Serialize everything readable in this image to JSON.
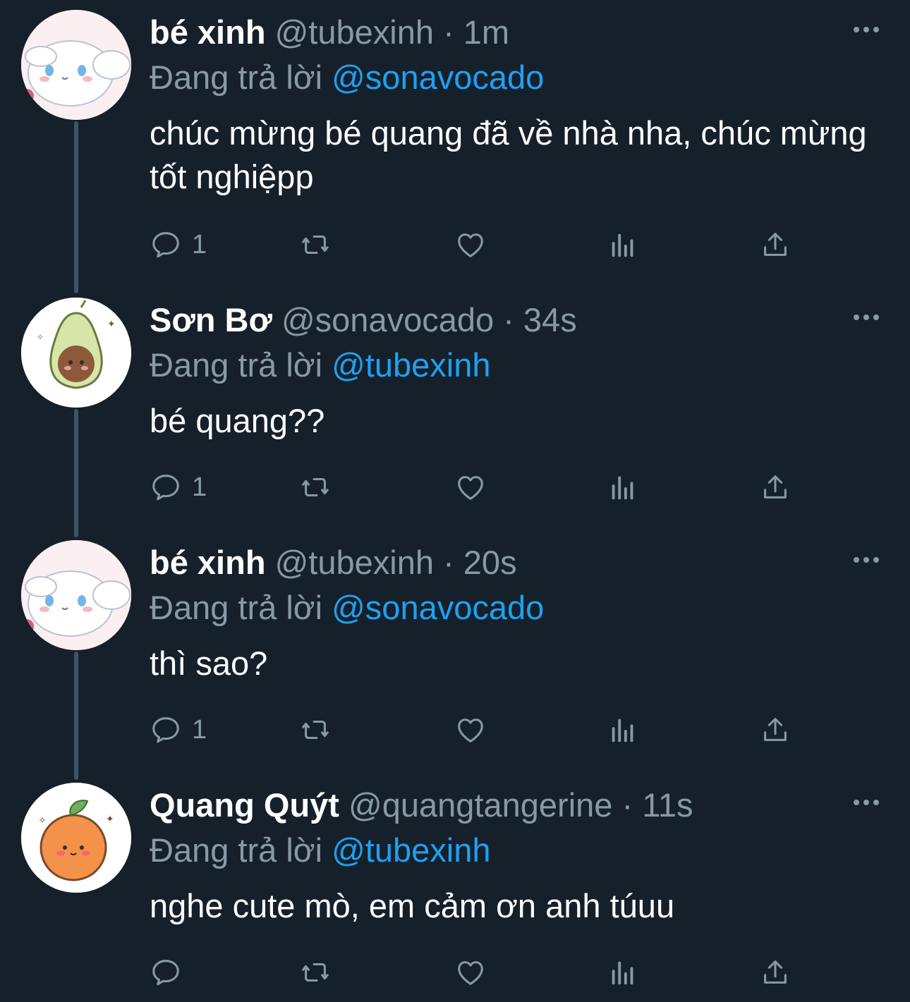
{
  "tweets": [
    {
      "name": "bé xinh",
      "handle": "@tubexinh",
      "dot": "·",
      "time": "1m",
      "reply_prefix": "Đang trả lời",
      "reply_to": "@sonavocado",
      "text": "chúc mừng bé quang đã về nhà nha, chúc mừng tốt nghiệpp",
      "reply_count": "1",
      "avatar": "cinnamoroll-avatar"
    },
    {
      "name": "Sơn Bơ",
      "handle": "@sonavocado",
      "dot": "·",
      "time": "34s",
      "reply_prefix": "Đang trả lời",
      "reply_to": "@tubexinh",
      "text": "bé quang??",
      "reply_count": "1",
      "avatar": "avocado-avatar"
    },
    {
      "name": "bé xinh",
      "handle": "@tubexinh",
      "dot": "·",
      "time": "20s",
      "reply_prefix": "Đang trả lời",
      "reply_to": "@sonavocado",
      "text": "thì sao?",
      "reply_count": "1",
      "avatar": "cinnamoroll-avatar"
    },
    {
      "name": "Quang Quýt",
      "handle": "@quangtangerine",
      "dot": "·",
      "time": "11s",
      "reply_prefix": "Đang trả lời",
      "reply_to": "@tubexinh",
      "text": "nghe cute mò, em cảm ơn anh túuu",
      "reply_count": "",
      "avatar": "tangerine-avatar"
    }
  ],
  "icons": {
    "reply": "reply-icon",
    "retweet": "retweet-icon",
    "like": "heart-icon",
    "analytics": "analytics-icon",
    "share": "share-icon",
    "more": "more-icon"
  },
  "colors": {
    "background": "#15202b",
    "secondary_text": "#8899a6",
    "mention": "#1da1f2",
    "thread_line": "#3d5466"
  }
}
